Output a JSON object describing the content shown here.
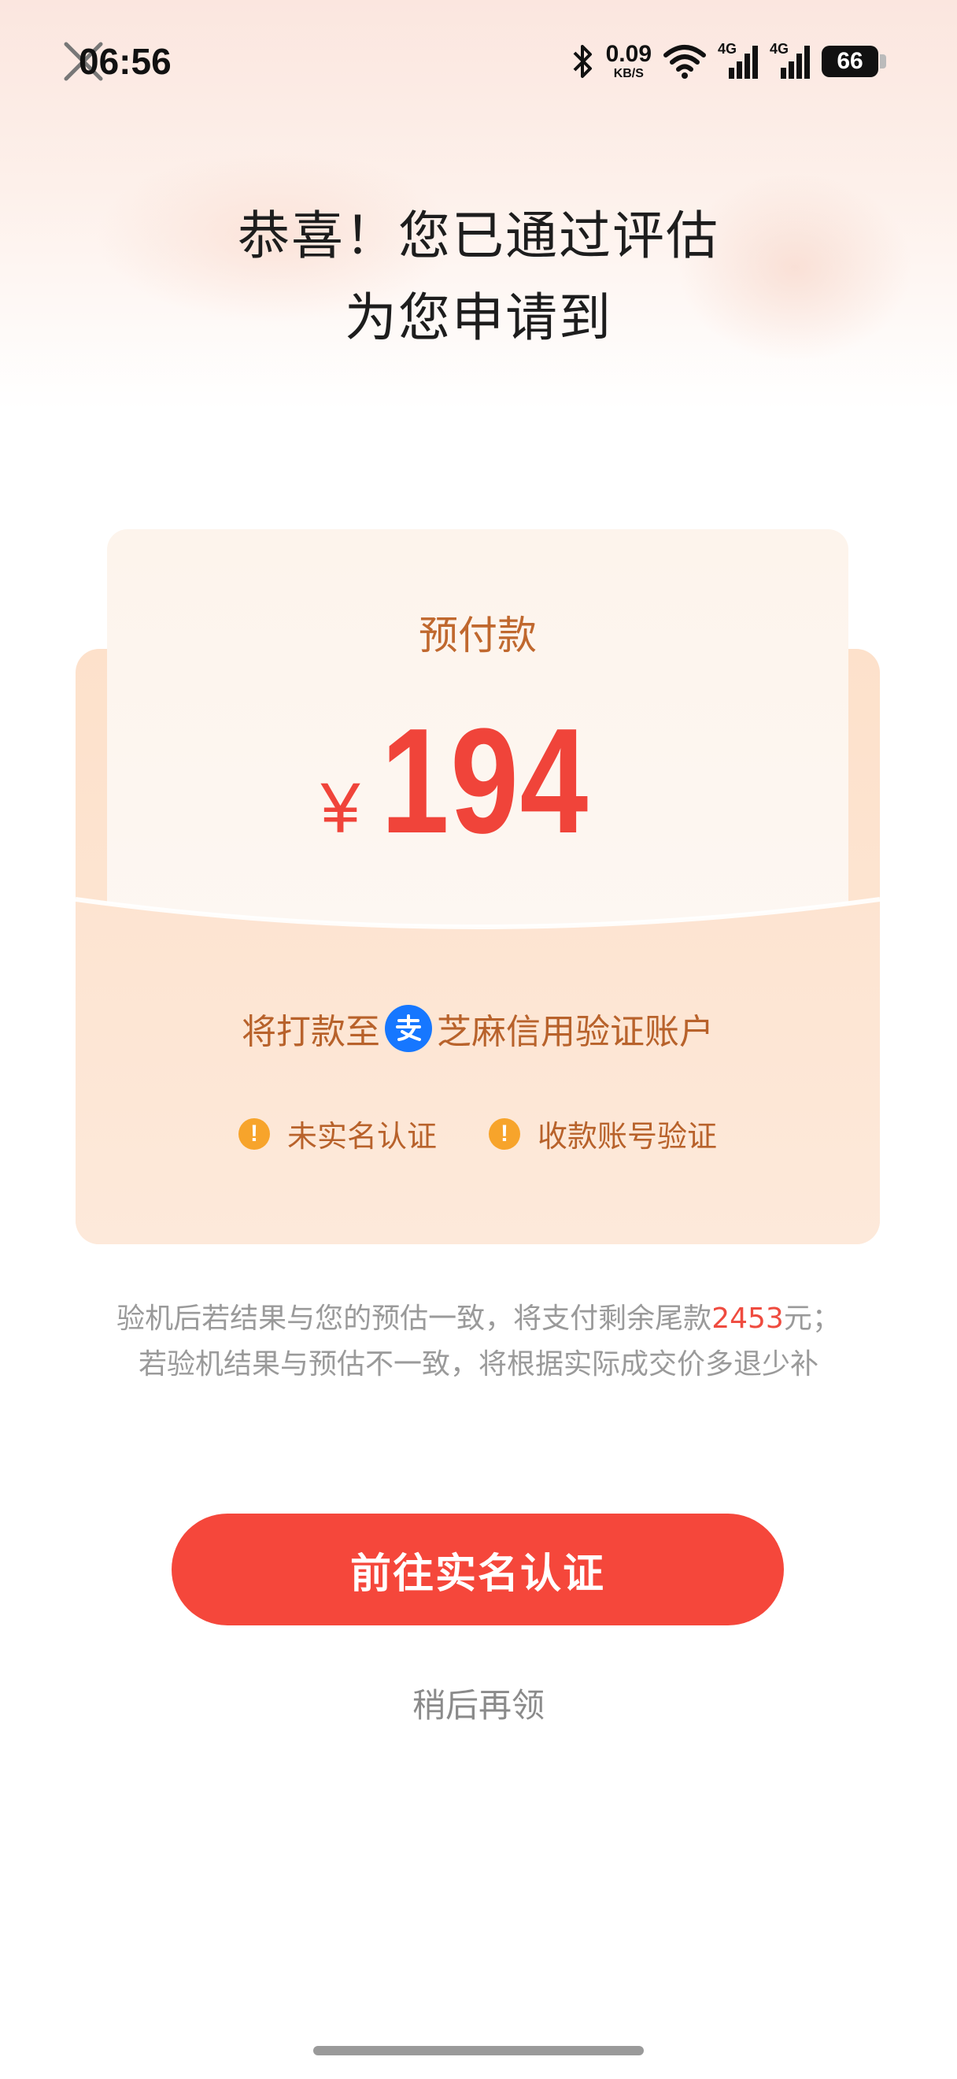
{
  "status_bar": {
    "time": "06:56",
    "net_speed_value": "0.09",
    "net_speed_unit": "KB/S",
    "signal_1_label": "4G",
    "signal_2_label": "4G",
    "battery": "66",
    "icons": [
      "close-icon",
      "bluetooth-icon",
      "wifi-icon",
      "signal-icon",
      "signal-icon",
      "battery-icon"
    ]
  },
  "header": {
    "line1": "恭喜！您已通过评估",
    "line2": "为您申请到"
  },
  "card": {
    "label": "预付款",
    "currency": "¥",
    "amount": "194",
    "payto_prefix": "将打款至",
    "payto_suffix": "芝麻信用验证账户",
    "payment_icon": "alipay-icon",
    "warnings": [
      {
        "text": "未实名认证",
        "icon": "warning-icon"
      },
      {
        "text": "收款账号验证",
        "icon": "warning-icon"
      }
    ]
  },
  "note": {
    "line1_prefix": "验机后若结果与您的预估一致，将支付剩余尾款",
    "line1_amount": "2453",
    "line1_suffix": "元；",
    "line2": "若验机结果与预估不一致，将根据实际成交价多退少补"
  },
  "actions": {
    "primary": "前往实名认证",
    "secondary": "稍后再领"
  },
  "colors": {
    "accent": "#f5473b",
    "amount": "#f0443a",
    "card_text": "#b8622b",
    "warning": "#f7a42b",
    "alipay": "#1677ff"
  }
}
